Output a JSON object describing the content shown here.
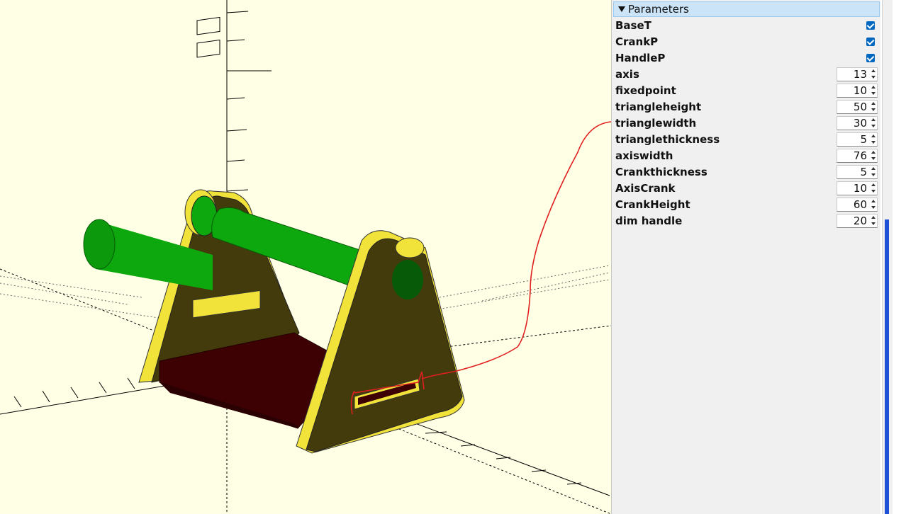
{
  "panel": {
    "title": "Parameters",
    "checkboxes": [
      {
        "label": "BaseT",
        "checked": true
      },
      {
        "label": "CrankP",
        "checked": true
      },
      {
        "label": "HandleP",
        "checked": true
      }
    ],
    "numbers": [
      {
        "label": "axis",
        "value": "13"
      },
      {
        "label": "fixedpoint",
        "value": "10"
      },
      {
        "label": "triangleheight",
        "value": "50"
      },
      {
        "label": "trianglewidth",
        "value": "30"
      },
      {
        "label": "trianglethickness",
        "value": "5"
      },
      {
        "label": "axiswidth",
        "value": "76"
      },
      {
        "label": "Crankthickness",
        "value": "5"
      },
      {
        "label": "AxisCrank",
        "value": "10"
      },
      {
        "label": "CrankHeight",
        "value": "60"
      },
      {
        "label": "dim handle",
        "value": "20"
      }
    ]
  },
  "colors": {
    "viewport_bg": "#ffffe5",
    "frame_face": "#433b0c",
    "frame_edge": "#f2e33a",
    "axle": "#0da80d",
    "axle_dark": "#075a07",
    "base_plate": "#3d0003",
    "annotation": "#e02020",
    "accent": "#1f4fd6"
  }
}
